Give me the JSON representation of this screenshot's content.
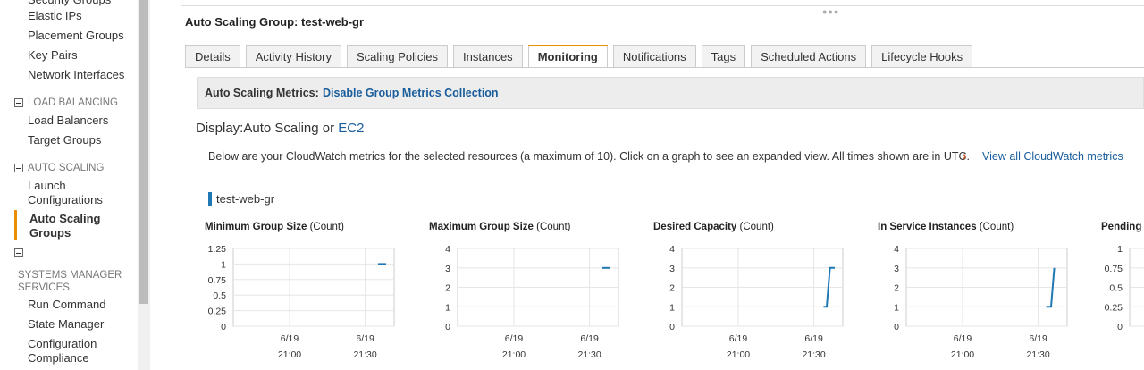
{
  "sidebar": {
    "items_top": [
      "Security Groups",
      "Elastic IPs",
      "Placement Groups",
      "Key Pairs",
      "Network Interfaces"
    ],
    "load_balancing": {
      "header": "LOAD BALANCING",
      "items": [
        "Load Balancers",
        "Target Groups"
      ]
    },
    "auto_scaling": {
      "header": "AUTO SCALING",
      "items": [
        "Launch Configurations",
        "Auto Scaling Groups"
      ],
      "active": "Auto Scaling Groups"
    },
    "systems_manager": {
      "header": "SYSTEMS MANAGER SERVICES",
      "items": [
        "Run Command",
        "State Manager",
        "Configuration Compliance"
      ]
    }
  },
  "main": {
    "title": "Auto Scaling Group: test-web-gr",
    "tabs": [
      "Details",
      "Activity History",
      "Scaling Policies",
      "Instances",
      "Monitoring",
      "Notifications",
      "Tags",
      "Scheduled Actions",
      "Lifecycle Hooks"
    ],
    "active_tab": "Monitoring",
    "metrics_label": "Auto Scaling Metrics:",
    "metrics_link": "Disable Group Metrics Collection",
    "display_prefix": "Display:",
    "display_current": "Auto Scaling",
    "display_or": "or",
    "display_alt": "EC2",
    "info": "Below are your CloudWatch metrics for the selected resources (a maximum of 10). Click on a graph to see an expanded view. All times shown are in UTC.",
    "cloudwatch_link": "View all CloudWatch metrics",
    "legend": "test-web-gr"
  },
  "colors": {
    "accent": "#e88e00",
    "link": "#1a5d9c",
    "series": "#1f77b4"
  },
  "chart_data": [
    {
      "type": "line",
      "title": "Minimum Group Size",
      "unit": "(Count)",
      "y_ticks": [
        "1.25",
        "1",
        "0.75",
        "0.5",
        "0.25",
        "0"
      ],
      "ylim": [
        0,
        1.25
      ],
      "x_ticks": [
        [
          "6/19",
          "21:00"
        ],
        [
          "6/19",
          "21:30"
        ]
      ],
      "series": [
        {
          "x": [
            0.9,
            0.95
          ],
          "y": [
            1,
            1
          ]
        }
      ]
    },
    {
      "type": "line",
      "title": "Maximum Group Size",
      "unit": "(Count)",
      "y_ticks": [
        "4",
        "3",
        "2",
        "1",
        "0"
      ],
      "ylim": [
        0,
        4
      ],
      "x_ticks": [
        [
          "6/19",
          "21:00"
        ],
        [
          "6/19",
          "21:30"
        ]
      ],
      "series": [
        {
          "x": [
            0.9,
            0.95
          ],
          "y": [
            3,
            3
          ]
        }
      ]
    },
    {
      "type": "line",
      "title": "Desired Capacity",
      "unit": "(Count)",
      "y_ticks": [
        "4",
        "3",
        "2",
        "1",
        "0"
      ],
      "ylim": [
        0,
        4
      ],
      "x_ticks": [
        [
          "6/19",
          "21:00"
        ],
        [
          "6/19",
          "21:30"
        ]
      ],
      "series": [
        {
          "x": [
            0.88,
            0.9,
            0.92,
            0.95
          ],
          "y": [
            1,
            1,
            3,
            3
          ]
        }
      ]
    },
    {
      "type": "line",
      "title": "In Service Instances",
      "unit": "(Count)",
      "y_ticks": [
        "4",
        "3",
        "2",
        "1",
        "0"
      ],
      "ylim": [
        0,
        4
      ],
      "x_ticks": [
        [
          "6/19",
          "21:00"
        ],
        [
          "6/19",
          "21:30"
        ]
      ],
      "series": [
        {
          "x": [
            0.87,
            0.9,
            0.92
          ],
          "y": [
            1,
            1,
            3
          ]
        }
      ]
    },
    {
      "type": "line",
      "title": "Pending I",
      "unit": "",
      "y_ticks": [
        "1",
        "0.75",
        "0.5",
        "0.25",
        "0"
      ],
      "ylim": [
        0,
        1
      ],
      "x_ticks": [],
      "series": []
    }
  ]
}
